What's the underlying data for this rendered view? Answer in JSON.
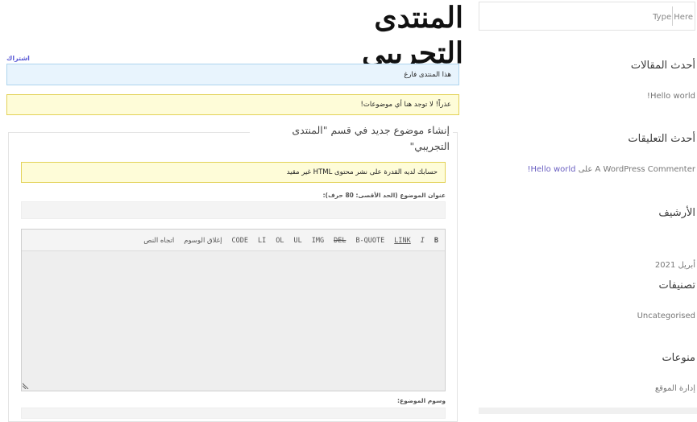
{
  "main": {
    "page_title": "المنتدى التجريبي",
    "subscribe_link": "اشتراك",
    "forum_empty_notice": "هذا المنتدى فارغ",
    "no_topics_notice": "عذراً! لا توجد هنا أي موضوعات!",
    "form": {
      "legend": "إنشاء موضوع جديد في قسم \"المنتدى التجريبي\"",
      "html_notice": "حسابك لديه القدرة على نشر محتوى HTML غير مقيد",
      "title_label": "عنوان الموضوع (الحد الأقصى: 80 حرف):",
      "title_value": "",
      "tags_label": "وسوم الموضوع:",
      "tags_value": "",
      "content_value": "",
      "toolbar": {
        "b": "B",
        "i": "I",
        "link": "LINK",
        "bquote": "B-QUOTE",
        "del": "DEL",
        "img": "IMG",
        "ul": "UL",
        "ol": "OL",
        "li": "LI",
        "code": "CODE",
        "close_tags": "إغلاق الوسوم",
        "direction": "اتجاه النص"
      }
    }
  },
  "sidebar": {
    "search_placeholder": "Type Here",
    "recent_posts_title": "أحدث المقالات",
    "recent_posts": [
      "Hello world!"
    ],
    "recent_comments_title": "أحدث التعليقات",
    "recent_comment": {
      "author": "A WordPress Commenter",
      "on": "على",
      "post": "Hello world!"
    },
    "archives_title": "الأرشيف",
    "archives": [
      "أبريل 2021"
    ],
    "categories_title": "تصنيفات",
    "categories": [
      "Uncategorised"
    ],
    "meta_title": "منوعات",
    "meta": [
      "إدارة الموقع"
    ]
  },
  "colors": {
    "link": "#6a5fc1",
    "info_bg": "#e8f4fd",
    "info_border": "#aed4ee",
    "warning_bg": "#fefcd8",
    "warning_border": "#e3d257"
  }
}
